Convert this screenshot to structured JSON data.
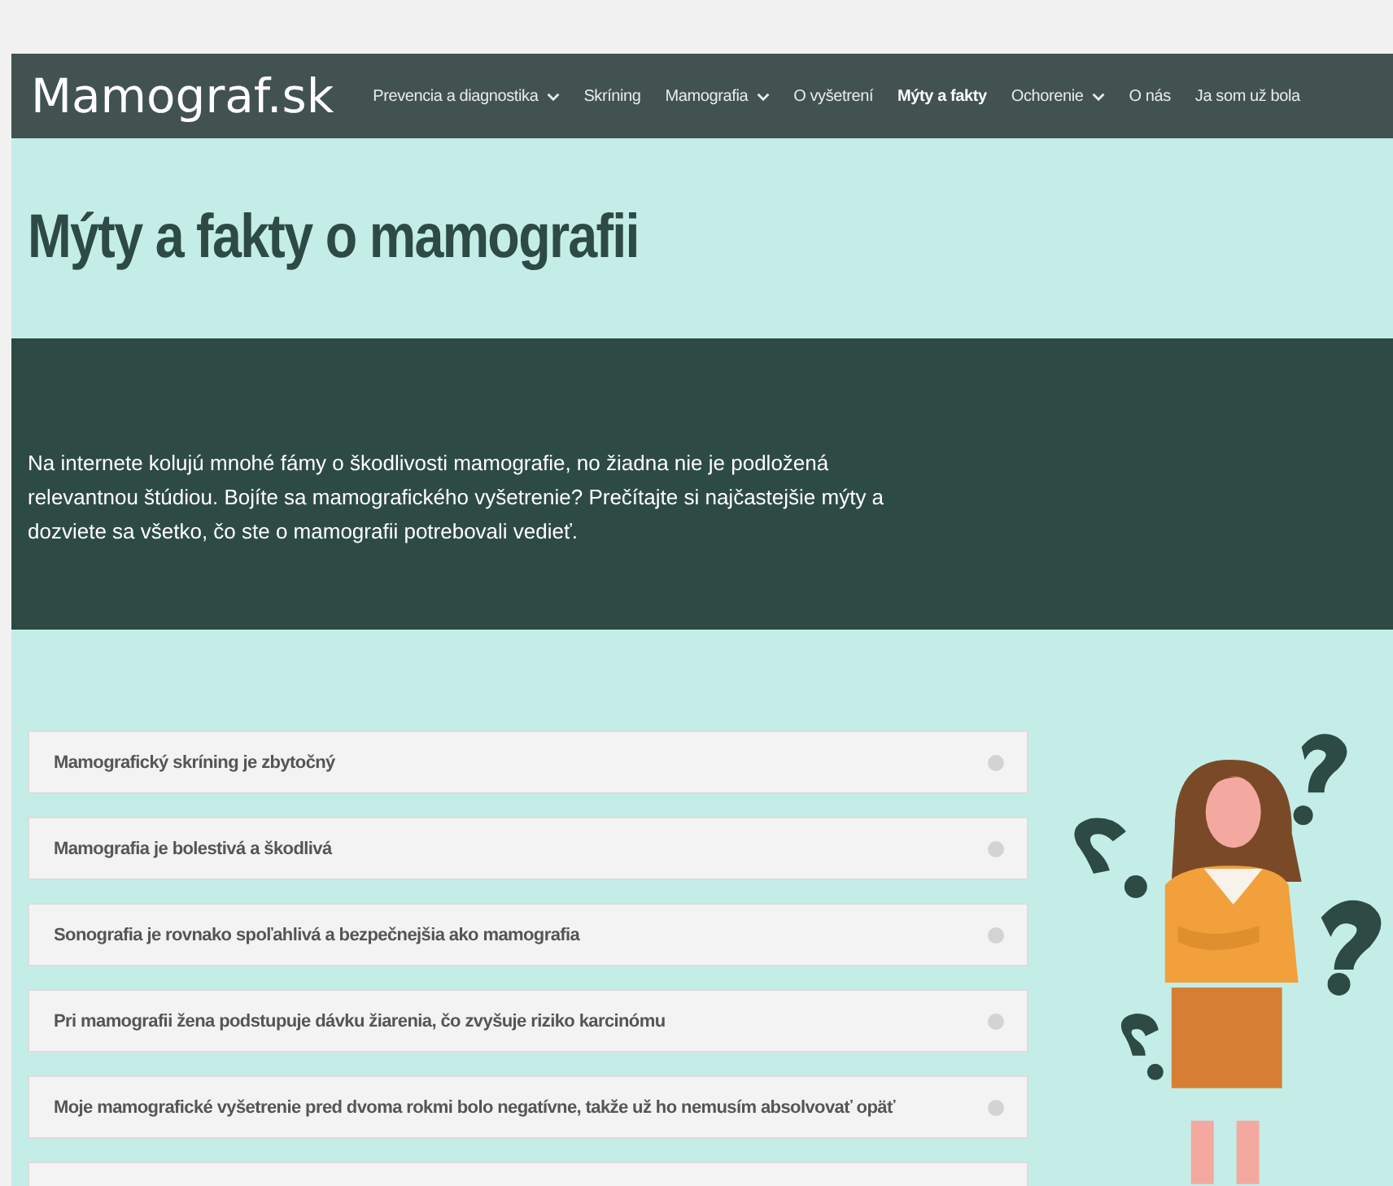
{
  "header": {
    "logo": "Mamograf.sk",
    "nav": [
      {
        "label": "Prevencia a diagnostika",
        "dropdown": true,
        "selected": false
      },
      {
        "label": "Skríning",
        "dropdown": false,
        "selected": false
      },
      {
        "label": "Mamografia",
        "dropdown": true,
        "selected": false
      },
      {
        "label": "O vyšetrení",
        "dropdown": false,
        "selected": false
      },
      {
        "label": "Mýty a fakty",
        "dropdown": false,
        "selected": true
      },
      {
        "label": "Ochorenie",
        "dropdown": true,
        "selected": false
      },
      {
        "label": "O nás",
        "dropdown": false,
        "selected": false
      },
      {
        "label": "Ja som už bola",
        "dropdown": false,
        "selected": false
      }
    ]
  },
  "page_title": "Mýty a fakty o mamografii",
  "intro": "Na internete kolujú mnohé fámy o škodlivosti mamografie, no žiadna nie je podložená relevantnou štúdiou. Bojíte sa mamografického vyšetrenie? Prečítajte si najčastejšie mýty a dozviete sa všetko, čo ste o mamografii potrebovali vedieť.",
  "myths": [
    {
      "title": "Mamografický skríning je zbytočný"
    },
    {
      "title": "Mamografia je bolestivá a škodlivá"
    },
    {
      "title": "Sonografia je rovnako spoľahlivá a bezpečnejšia ako mamografia"
    },
    {
      "title": "Pri mamografii žena podstupuje dávku žiarenia, čo zvyšuje riziko karcinómu"
    },
    {
      "title": "Moje mamografické vyšetrenie pred dvoma rokmi bolo negatívne, takže už ho nemusím absolvovať opäť"
    }
  ]
}
